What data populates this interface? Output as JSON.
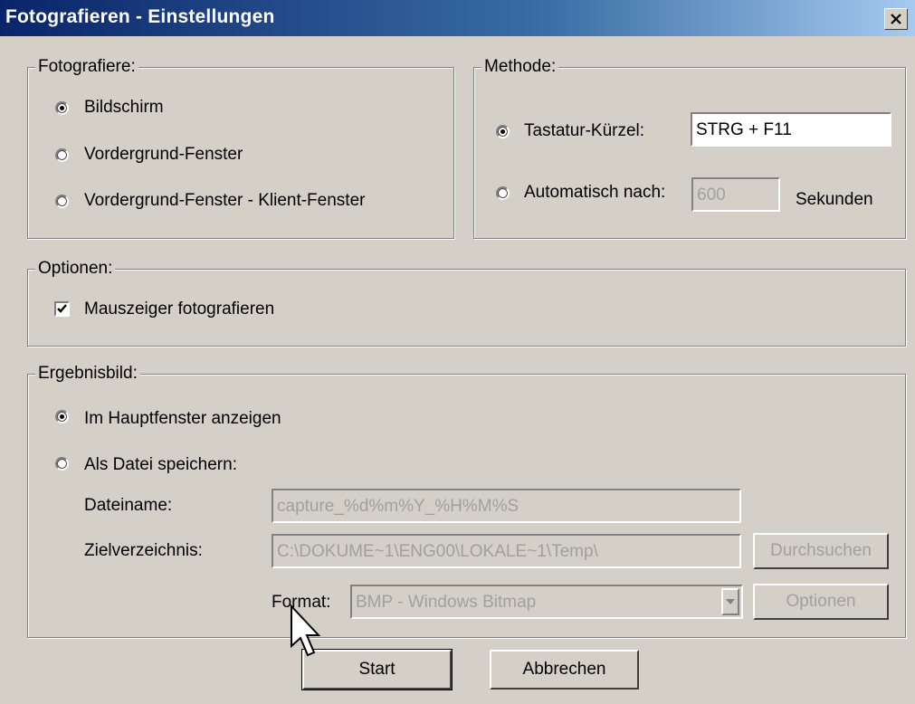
{
  "window": {
    "title": "Fotografieren - Einstellungen"
  },
  "fotografiere": {
    "label": "Fotografiere:",
    "options": [
      "Bildschirm",
      "Vordergrund-Fenster",
      "Vordergrund-Fenster - Klient-Fenster"
    ],
    "selected": "Bildschirm"
  },
  "methode": {
    "label": "Methode:",
    "hotkey_label": "Tastatur-Kürzel:",
    "hotkey_value": "STRG + F11",
    "auto_label": "Automatisch nach:",
    "auto_value": "600",
    "auto_unit": "Sekunden",
    "selected": "Tastatur-Kürzel:"
  },
  "optionen": {
    "label": "Optionen:",
    "mouse_pointer_label": "Mauszeiger fotografieren",
    "mouse_pointer_checked": true
  },
  "ergebnisbild": {
    "label": "Ergebnisbild:",
    "show_main_label": "Im Hauptfenster anzeigen",
    "save_file_label": "Als Datei speichern:",
    "selected": "Im Hauptfenster anzeigen",
    "filename_label": "Dateiname:",
    "filename_value": "capture_%d%m%Y_%H%M%S",
    "directory_label": "Zielverzeichnis:",
    "directory_value": "C:\\DOKUME~1\\ENG00\\LOKALE~1\\Temp\\",
    "browse_label": "Durchsuchen",
    "format_label": "Format:",
    "format_value": "BMP - Windows Bitmap",
    "format_options_label": "Optionen"
  },
  "buttons": {
    "start": "Start",
    "cancel": "Abbrechen"
  },
  "colors": {
    "title_start": "#0a246a",
    "title_end": "#a6caf0",
    "face": "#d4d0c8"
  }
}
